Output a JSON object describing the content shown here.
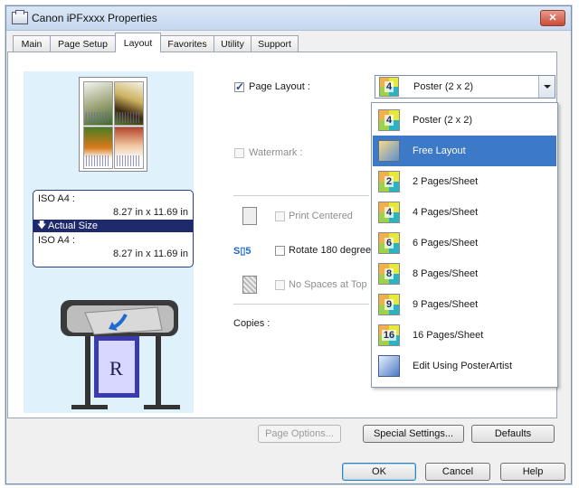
{
  "window": {
    "title": "Canon iPFxxxx Properties",
    "close_label": "✕"
  },
  "tabs": [
    "Main",
    "Page Setup",
    "Layout",
    "Favorites",
    "Utility",
    "Support"
  ],
  "active_tab": "Layout",
  "preview": {
    "size_top_name": "ISO A4 :",
    "size_top_dims": "8.27 in x 11.69 in",
    "actual_size_label": "Actual Size",
    "size_bottom_name": "ISO A4 :",
    "size_bottom_dims": "8.27 in x 11.69 in"
  },
  "options": {
    "page_layout_label": "Page Layout :",
    "page_layout_checked": true,
    "watermark_label": "Watermark :",
    "print_centered_label": "Print Centered",
    "rotate_label": "Rotate 180 degrees",
    "no_spaces_label": "No Spaces at Top",
    "copies_label": "Copies :"
  },
  "layout_select": {
    "selected": "Poster (2 x 2)",
    "options": [
      {
        "label": "Poster (2 x 2)",
        "icon": "poster-2x2-icon",
        "badge": "4"
      },
      {
        "label": "Free Layout",
        "icon": "free-layout-icon",
        "badge": ""
      },
      {
        "label": "2 Pages/Sheet",
        "icon": "2-pages-icon",
        "badge": "2"
      },
      {
        "label": "4 Pages/Sheet",
        "icon": "4-pages-icon",
        "badge": "4"
      },
      {
        "label": "6 Pages/Sheet",
        "icon": "6-pages-icon",
        "badge": "6"
      },
      {
        "label": "8 Pages/Sheet",
        "icon": "8-pages-icon",
        "badge": "8"
      },
      {
        "label": "9 Pages/Sheet",
        "icon": "9-pages-icon",
        "badge": "9"
      },
      {
        "label": "16 Pages/Sheet",
        "icon": "16-pages-icon",
        "badge": "16"
      },
      {
        "label": "Edit Using PosterArtist",
        "icon": "posterartist-icon",
        "badge": ""
      }
    ],
    "highlighted": "Free Layout"
  },
  "buttons": {
    "page_options": "Page Options...",
    "special_settings": "Special Settings...",
    "defaults": "Defaults",
    "ok": "OK",
    "cancel": "Cancel",
    "help": "Help"
  },
  "colors": {
    "selection": "#3c79c6",
    "preview_bg": "#dff1fb",
    "size_bar": "#1e2a6b"
  }
}
